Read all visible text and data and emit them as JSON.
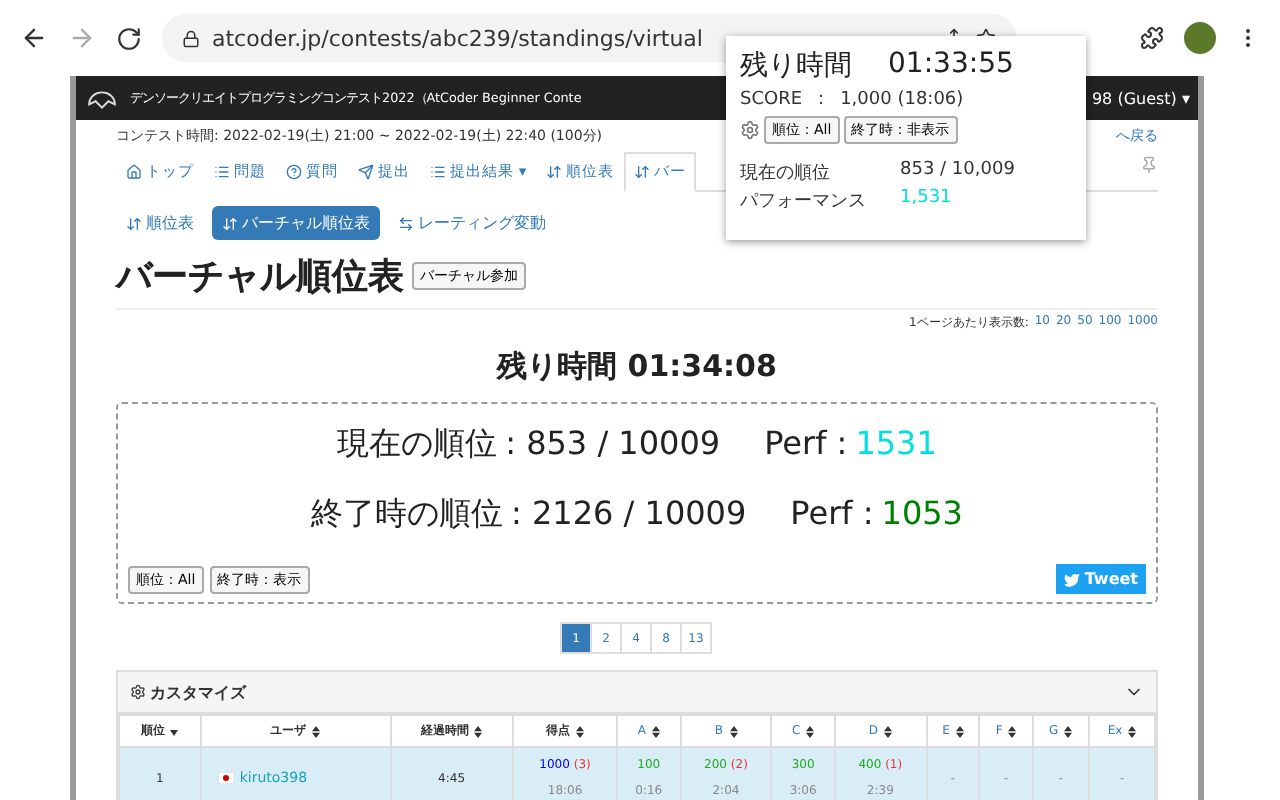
{
  "browser": {
    "url": "atcoder.jp/contests/abc239/standings/virtual"
  },
  "header": {
    "title": "デンソークリエイトプログラミングコンテスト2022（AtCoder Beginner Conte",
    "user": "98 (Guest) ▾"
  },
  "contest_time": "コンテスト時間: 2022-02-19(土) 21:00 ~ 2022-02-19(土) 22:40 (100分)",
  "back_link": "へ戻る",
  "nav_tabs": [
    {
      "label": "トップ",
      "selected": false
    },
    {
      "label": "問題",
      "selected": false
    },
    {
      "label": "質問",
      "selected": false
    },
    {
      "label": "提出",
      "selected": false
    },
    {
      "label": "提出結果 ▾",
      "selected": false
    },
    {
      "label": "順位表",
      "selected": false
    },
    {
      "label": "バー",
      "selected": true
    }
  ],
  "sub_tabs": [
    {
      "label": "順位表",
      "selected": false
    },
    {
      "label": "バーチャル順位表",
      "selected": true
    },
    {
      "label": "レーティング変動",
      "selected": false
    }
  ],
  "page_title": "バーチャル順位表",
  "join_button": "バーチャル参加",
  "per_page": {
    "label": "1ページあたり表示数:",
    "options": [
      "10",
      "20",
      "50",
      "100",
      "1000"
    ]
  },
  "remaining": "残り時間 01:34:08",
  "summary": {
    "lines": [
      {
        "label": "現在の順位",
        "rank": ": 853 / 10009",
        "perf_label": "Perf :",
        "perf": "1531",
        "color": "#00e0e0"
      },
      {
        "label": "終了時の順位",
        "rank": ": 2126 / 10009",
        "perf_label": "Perf :",
        "perf": "1053",
        "color": "#008000"
      }
    ],
    "buttons": [
      "順位：All",
      "終了時：表示"
    ],
    "tweet": "Tweet"
  },
  "pages": [
    {
      "label": "1",
      "selected": true
    },
    {
      "label": "2",
      "selected": false
    },
    {
      "label": "4",
      "selected": false
    },
    {
      "label": "8",
      "selected": false
    },
    {
      "label": "13",
      "selected": false
    }
  ],
  "customize": "カスタマイズ",
  "table": {
    "columns": [
      {
        "label": "順位",
        "kind": "rank"
      },
      {
        "label": "ユーザ",
        "kind": "sort"
      },
      {
        "label": "経過時間",
        "kind": "sort"
      },
      {
        "label": "得点",
        "kind": "sort"
      },
      {
        "label": "A",
        "kind": "task"
      },
      {
        "label": "B",
        "kind": "task"
      },
      {
        "label": "C",
        "kind": "task"
      },
      {
        "label": "D",
        "kind": "task"
      },
      {
        "label": "E",
        "kind": "task"
      },
      {
        "label": "F",
        "kind": "task"
      },
      {
        "label": "G",
        "kind": "task"
      },
      {
        "label": "Ex",
        "kind": "task"
      }
    ],
    "rows": [
      {
        "cells": [
          {
            "kind": "rank",
            "text": "1"
          },
          {
            "kind": "user",
            "text": "kiruto398"
          },
          {
            "kind": "elapsed",
            "text": "4:45"
          },
          {
            "kind": "score",
            "points": "1000",
            "penalty": "(3)",
            "time": "18:06"
          },
          {
            "kind": "task",
            "points": "100",
            "time": "0:16"
          },
          {
            "kind": "task",
            "points": "200",
            "penalty": "(2)",
            "time": "2:04"
          },
          {
            "kind": "task",
            "points": "300",
            "time": "3:06"
          },
          {
            "kind": "task",
            "points": "400",
            "penalty": "(1)",
            "time": "2:39"
          },
          {
            "kind": "empty",
            "text": "-"
          },
          {
            "kind": "empty",
            "text": "-"
          },
          {
            "kind": "empty",
            "text": "-"
          },
          {
            "kind": "empty",
            "text": "-"
          }
        ]
      }
    ]
  },
  "popup": {
    "title": "残り時間",
    "time": "01:33:55",
    "score_label": "SCORE",
    "score_sep": ":",
    "score": "1,000 (18:06)",
    "buttons": [
      "順位：All",
      "終了時：非表示"
    ],
    "rows": [
      {
        "label": "現在の順位",
        "value": "853 / 10,009",
        "color": "#333333"
      },
      {
        "label": "パフォーマンス",
        "value": "1,531",
        "color": "#00e0e0"
      }
    ]
  }
}
